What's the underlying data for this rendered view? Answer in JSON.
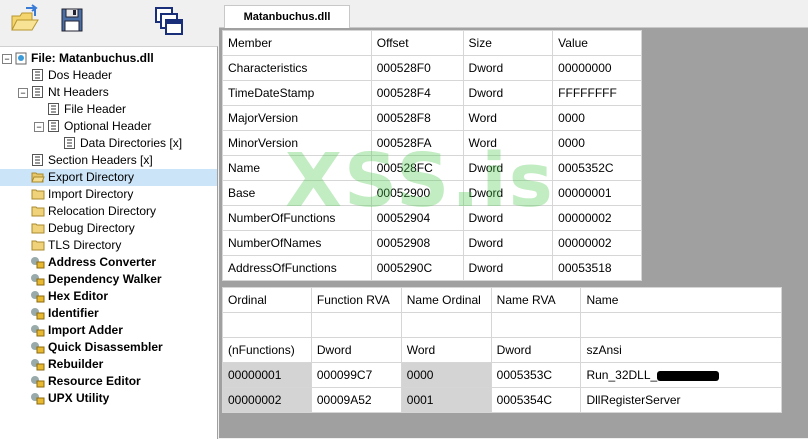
{
  "toolbar": {
    "buttons": [
      "open-file-icon",
      "save-file-icon",
      "windows-icon"
    ]
  },
  "tree": {
    "root": "File: Matanbuchus.dll",
    "dos_header": "Dos Header",
    "nt_headers": "Nt Headers",
    "file_header": "File Header",
    "optional_header": "Optional Header",
    "data_directories": "Data Directories [x]",
    "section_headers": "Section Headers [x]",
    "export_directory": "Export Directory",
    "import_directory": "Import Directory",
    "relocation_directory": "Relocation Directory",
    "debug_directory": "Debug Directory",
    "tls_directory": "TLS Directory",
    "address_converter": "Address Converter",
    "dependency_walker": "Dependency Walker",
    "hex_editor": "Hex Editor",
    "identifier": "Identifier",
    "import_adder": "Import Adder",
    "quick_disassembler": "Quick Disassembler",
    "rebuilder": "Rebuilder",
    "resource_editor": "Resource Editor",
    "upx_utility": "UPX Utility"
  },
  "tab": {
    "label": "Matanbuchus.dll"
  },
  "export_table": {
    "headers": [
      "Member",
      "Offset",
      "Size",
      "Value"
    ],
    "rows": [
      [
        "Characteristics",
        "000528F0",
        "Dword",
        "00000000"
      ],
      [
        "TimeDateStamp",
        "000528F4",
        "Dword",
        "FFFFFFFF"
      ],
      [
        "MajorVersion",
        "000528F8",
        "Word",
        "0000"
      ],
      [
        "MinorVersion",
        "000528FA",
        "Word",
        "0000"
      ],
      [
        "Name",
        "000528FC",
        "Dword",
        "0005352C"
      ],
      [
        "Base",
        "00052900",
        "Dword",
        "00000001"
      ],
      [
        "NumberOfFunctions",
        "00052904",
        "Dword",
        "00000002"
      ],
      [
        "NumberOfNames",
        "00052908",
        "Dword",
        "00000002"
      ],
      [
        "AddressOfFunctions",
        "0005290C",
        "Dword",
        "00053518"
      ]
    ]
  },
  "functions_table": {
    "headers": [
      "Ordinal",
      "Function RVA",
      "Name Ordinal",
      "Name RVA",
      "Name"
    ],
    "type_row": [
      "(nFunctions)",
      "Dword",
      "Word",
      "Dword",
      "szAnsi"
    ],
    "rows": [
      [
        "00000001",
        "000099C7",
        "0000",
        "0005353C",
        "Run_32DLL_"
      ],
      [
        "00000002",
        "00009A52",
        "0001",
        "0005354C",
        "DllRegisterServer"
      ]
    ]
  },
  "watermark": "XSS.is"
}
